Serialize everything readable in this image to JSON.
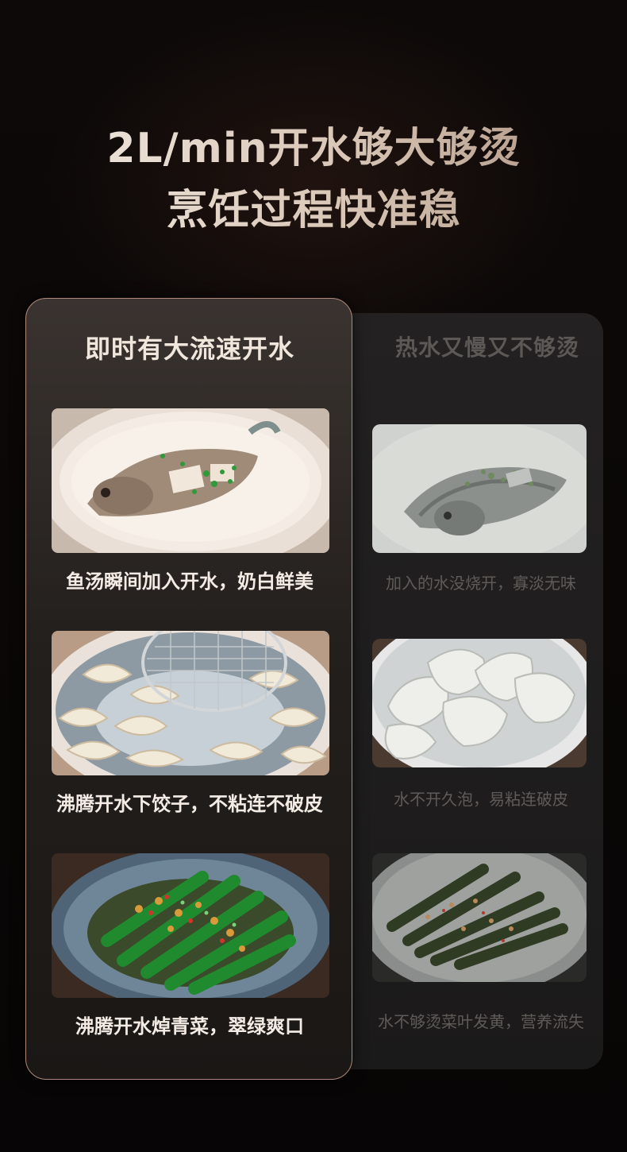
{
  "headline": {
    "line1": "2L/min开水够大够烫",
    "line2": "烹饪过程快准稳"
  },
  "left_column": {
    "title": "即时有大流速开水",
    "items": [
      {
        "photo_icon": "fish-soup-photo",
        "caption": "鱼汤瞬间加入开水，奶白鲜美"
      },
      {
        "photo_icon": "boiling-dumplings-photo",
        "caption": "沸腾开水下饺子，不粘连不破皮"
      },
      {
        "photo_icon": "okra-dish-photo",
        "caption": "沸腾开水焯青菜，翠绿爽口"
      }
    ]
  },
  "right_column": {
    "title": "热水又慢又不够烫",
    "items": [
      {
        "photo_icon": "bland-fish-soup-photo",
        "caption": "加入的水没烧开，寡淡无味"
      },
      {
        "photo_icon": "stuck-dumplings-photo",
        "caption": "水不开久泡，易粘连破皮"
      },
      {
        "photo_icon": "yellowed-okra-photo",
        "caption": "水不够烫菜叶发黄，营养流失"
      }
    ]
  },
  "colors": {
    "background": "#0b0807",
    "panel_highlight_border": "#b0897a",
    "text_bright": "#f4ece4",
    "text_dim": "#5f5b59"
  }
}
